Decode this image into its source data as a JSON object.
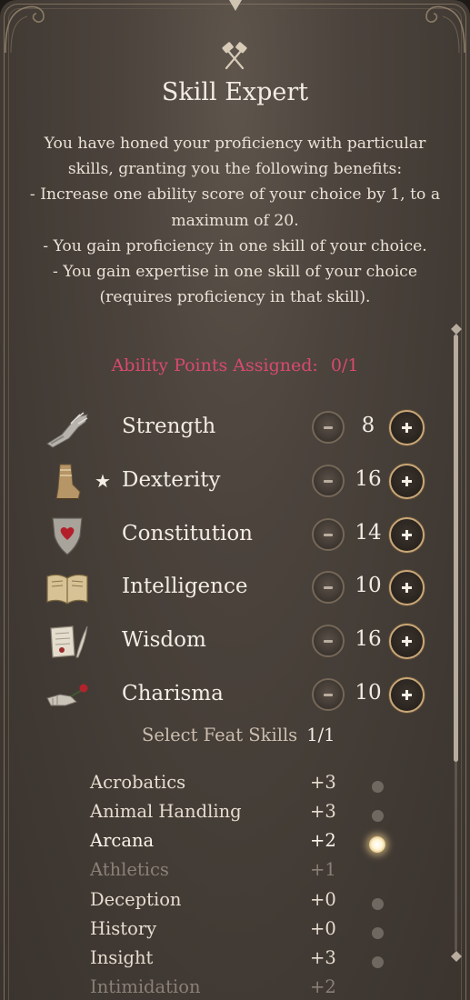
{
  "header": {
    "icon": "crossed-hammers-icon",
    "title": "Skill Expert",
    "description_lines": [
      "You have honed your proficiency with particular",
      "skills, granting you the following benefits:",
      "- Increase one ability score of your choice by 1, to a",
      "maximum of 20.",
      "- You gain proficiency in one skill of your choice.",
      "- You gain expertise in one skill of your choice",
      "(requires proficiency in that skill)."
    ]
  },
  "ability_points": {
    "label": "Ability Points Assigned:",
    "value": "0/1",
    "color": "#d9496f"
  },
  "abilities": [
    {
      "name": "Strength",
      "value": "8",
      "icon": "gauntlet-icon",
      "starred": false
    },
    {
      "name": "Dexterity",
      "value": "16",
      "icon": "boot-icon",
      "starred": true
    },
    {
      "name": "Constitution",
      "value": "14",
      "icon": "shield-heart-icon",
      "starred": false
    },
    {
      "name": "Intelligence",
      "value": "10",
      "icon": "open-book-icon",
      "starred": false
    },
    {
      "name": "Wisdom",
      "value": "16",
      "icon": "scroll-quill-icon",
      "starred": false
    },
    {
      "name": "Charisma",
      "value": "10",
      "icon": "hand-rose-icon",
      "starred": false
    }
  ],
  "star_glyph": "★",
  "feat_skills": {
    "label": "Select Feat Skills",
    "count": "1/1"
  },
  "skills": [
    {
      "name": "Acrobatics",
      "bonus": "+3",
      "state": "available"
    },
    {
      "name": "Animal Handling",
      "bonus": "+3",
      "state": "available"
    },
    {
      "name": "Arcana",
      "bonus": "+2",
      "state": "selected"
    },
    {
      "name": "Athletics",
      "bonus": "+1",
      "state": "disabled"
    },
    {
      "name": "Deception",
      "bonus": "+0",
      "state": "available"
    },
    {
      "name": "History",
      "bonus": "+0",
      "state": "available"
    },
    {
      "name": "Insight",
      "bonus": "+3",
      "state": "available"
    },
    {
      "name": "Intimidation",
      "bonus": "+2",
      "state": "disabled"
    }
  ]
}
